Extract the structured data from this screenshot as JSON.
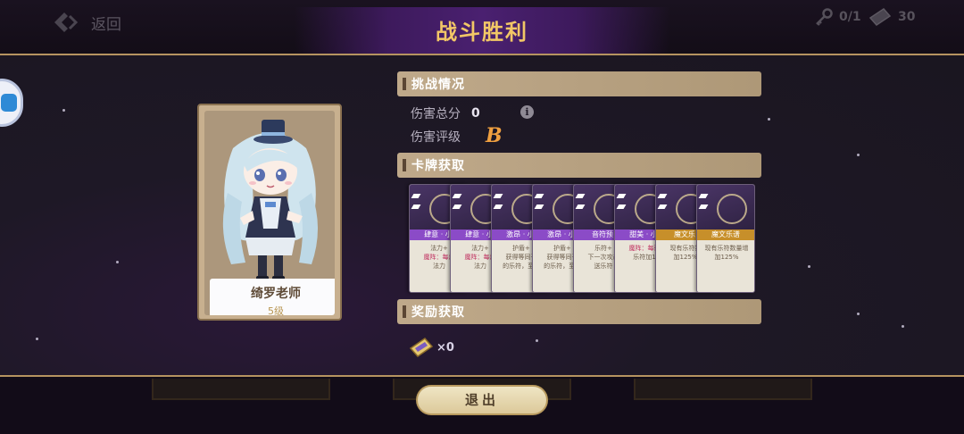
{
  "header": {
    "back_label": "返回",
    "title": "战斗胜利",
    "keys": "0/1",
    "tickets": "30"
  },
  "character": {
    "name": "绮罗老师",
    "level": "5级"
  },
  "challenge": {
    "section_title": "挑战情况",
    "damage_total_label": "伤害总分",
    "damage_total_value": "0",
    "damage_grade_label": "伤害评级",
    "damage_grade_value": "B"
  },
  "cards_section": {
    "section_title": "卡牌获取",
    "cards": [
      {
        "name": "肆意 · 小",
        "desc1": "法力+",
        "desc2": "魔阵：每炬",
        "desc3": "法力",
        "banner": "purple"
      },
      {
        "name": "肆意 · 小",
        "desc1": "法力+",
        "desc2": "魔阵：每炬",
        "desc3": "法力",
        "banner": "purple"
      },
      {
        "name": "激昂 · 小",
        "desc1": "护盾+",
        "desc2": "获得等同于",
        "desc3": "的乐符，至 2",
        "banner": "purple"
      },
      {
        "name": "激昂 · 小",
        "desc1": "护盾+",
        "desc2": "获得等同于",
        "desc3": "的乐符，至 2",
        "banner": "purple"
      },
      {
        "name": "音符预",
        "desc1": "乐符+",
        "desc2": "下一次攻击",
        "desc3": "送乐符",
        "banner": "purple"
      },
      {
        "name": "甜美 · 小",
        "desc1": "",
        "desc2": "魔阵：每获",
        "desc3": "乐符加1",
        "banner": "purple"
      },
      {
        "name": "魔文乐",
        "desc1": "",
        "desc2": "现有乐符数",
        "desc3": "加125%",
        "banner": "gold"
      },
      {
        "name": "魔文乐谱",
        "desc1": "",
        "desc2": "现有乐符数量增",
        "desc3": "加125%",
        "banner": "gold"
      }
    ]
  },
  "rewards": {
    "section_title": "奖励获取",
    "ticket_count": "×0"
  },
  "exit_label": "退出",
  "colors": {
    "gold_text": "#f2c766",
    "section_bar": "#bfa98a",
    "grade": "#f0a040",
    "purple_banner": "#8b4bc7",
    "gold_banner": "#c78f2a"
  }
}
